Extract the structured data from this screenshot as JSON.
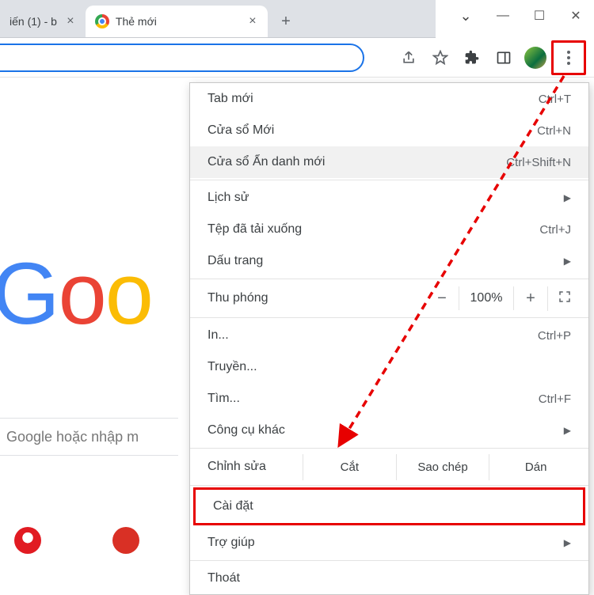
{
  "window_controls": {
    "dropdown": "⌄",
    "minimize": "—",
    "maximize": "☐",
    "close": "✕"
  },
  "tabs": {
    "inactive": {
      "title": "iến (1) - b"
    },
    "active": {
      "title": "Thẻ mới"
    }
  },
  "toolbar": {
    "search_placeholder": ""
  },
  "page": {
    "logo_letters": [
      "G",
      "o",
      "o"
    ],
    "search_hint": "Google hoặc nhập m"
  },
  "menu": {
    "new_tab": {
      "label": "Tab mới",
      "shortcut": "Ctrl+T"
    },
    "new_window": {
      "label": "Cửa sổ Mới",
      "shortcut": "Ctrl+N"
    },
    "incognito": {
      "label": "Cửa sổ Ẩn danh mới",
      "shortcut": "Ctrl+Shift+N"
    },
    "history": {
      "label": "Lịch sử"
    },
    "downloads": {
      "label": "Tệp đã tải xuống",
      "shortcut": "Ctrl+J"
    },
    "bookmarks": {
      "label": "Dấu trang"
    },
    "zoom": {
      "label": "Thu phóng",
      "minus": "−",
      "value": "100%",
      "plus": "+"
    },
    "print": {
      "label": "In...",
      "shortcut": "Ctrl+P"
    },
    "cast": {
      "label": "Truyền..."
    },
    "find": {
      "label": "Tìm...",
      "shortcut": "Ctrl+F"
    },
    "more_tools": {
      "label": "Công cụ khác"
    },
    "edit": {
      "label": "Chỉnh sửa",
      "cut": "Cắt",
      "copy": "Sao chép",
      "paste": "Dán"
    },
    "settings": {
      "label": "Cài đặt"
    },
    "help": {
      "label": "Trợ giúp"
    },
    "exit": {
      "label": "Thoát"
    }
  }
}
